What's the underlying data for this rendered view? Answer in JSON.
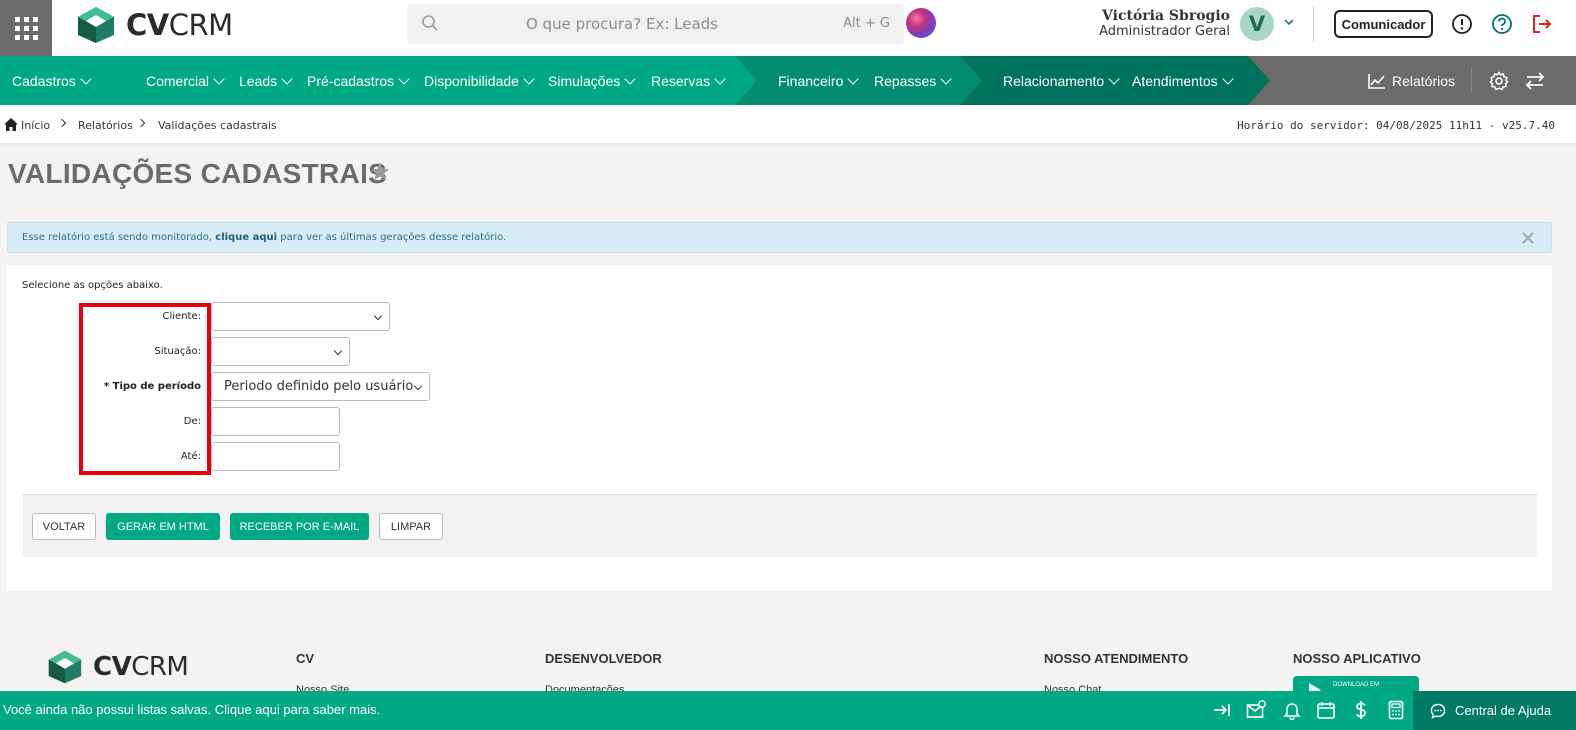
{
  "header": {
    "logo": {
      "text_bold": "CV",
      "text_light": "CRM"
    },
    "search": {
      "placeholder": "O que procura? Ex: Leads",
      "shortcut": "Alt + G"
    },
    "user": {
      "name": "Victória Sbrogio",
      "role": "Administrador Geral",
      "initial": "V"
    },
    "comunicador_label": "Comunicador",
    "icons": [
      "info-icon",
      "help-icon",
      "logout-icon"
    ]
  },
  "nav": {
    "items": [
      {
        "label": "Cadastros"
      },
      {
        "label": "Comercial"
      },
      {
        "label": "Leads"
      },
      {
        "label": "Pré-cadastros"
      },
      {
        "label": "Disponibilidade"
      },
      {
        "label": "Simulações"
      },
      {
        "label": "Reservas"
      },
      {
        "label": "Financeiro"
      },
      {
        "label": "Repasses"
      },
      {
        "label": "Relacionamento"
      },
      {
        "label": "Atendimentos"
      }
    ],
    "relatorios_label": "Relatórios",
    "colors": {
      "dark_teal": "#00735f",
      "mid_green": "#00a884",
      "gray": "#6b6b6b"
    }
  },
  "breadcrumb": {
    "items": [
      "Início",
      "Relatórios",
      "Validações cadastrais"
    ],
    "server_time": "Horário do servidor: 04/08/2025 11h11 - v25.7.40"
  },
  "page": {
    "title": "VALIDAÇÕES CADASTRAIS",
    "alert": {
      "prefix": "Esse relatório está sendo monitorado,",
      "link": "clique aqui",
      "suffix": "para ver as últimas gerações desse relatório."
    },
    "form": {
      "intro": "Selecione as opções abaixo.",
      "fields": [
        {
          "label": "Cliente:",
          "type": "select",
          "value": ""
        },
        {
          "label": "Situação:",
          "type": "select",
          "value": ""
        },
        {
          "label": "* Tipo de período",
          "type": "select",
          "value": "Periodo definido pelo usuário",
          "required": true
        },
        {
          "label": "De:",
          "type": "text",
          "value": ""
        },
        {
          "label": "Até:",
          "type": "text",
          "value": ""
        }
      ],
      "buttons": {
        "voltar": "VOLTAR",
        "gerar_html": "GERAR EM HTML",
        "receber_email": "RECEBER POR E-MAIL",
        "limpar": "LIMPAR"
      }
    }
  },
  "footer": {
    "columns": [
      {
        "title": "CV",
        "link": "Nosso Site"
      },
      {
        "title": "DESENVOLVEDOR",
        "link": "Documentações"
      },
      {
        "title": "NOSSO ATENDIMENTO",
        "link": "Nosso Chat"
      },
      {
        "title": "NOSSO APLICATIVO",
        "link": ""
      }
    ],
    "app_badge": "DOWNLOAD EM"
  },
  "bottom_bar": {
    "message": "Você ainda não possui listas salvas. Clique aqui para saber mais.",
    "help_label": "Central de Ajuda",
    "icons": [
      "collapse-right-icon",
      "mail-add-icon",
      "bell-icon",
      "calendar-icon",
      "dollar-icon",
      "calculator-icon"
    ]
  }
}
